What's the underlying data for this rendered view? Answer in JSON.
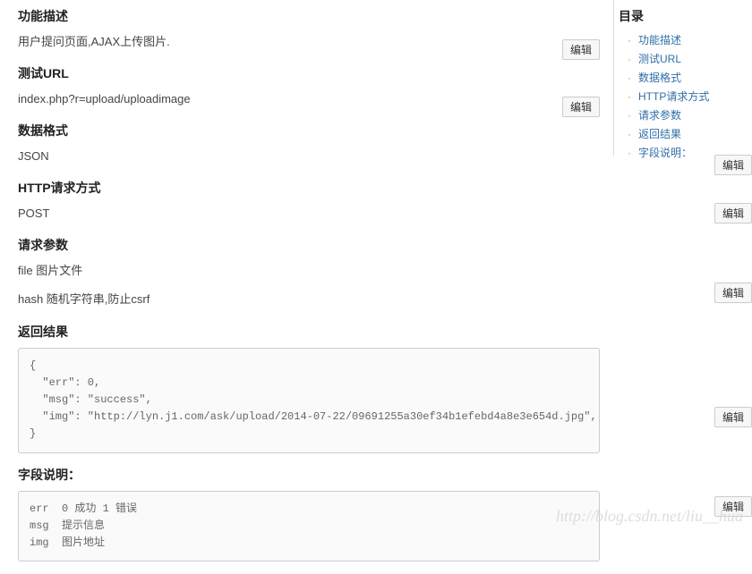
{
  "edit_label": "编辑",
  "sections": {
    "desc": {
      "title": "功能描述",
      "body": "用户提问页面,AJAX上传图片."
    },
    "url": {
      "title": "测试URL",
      "body": "index.php?r=upload/uploadimage"
    },
    "format": {
      "title": "数据格式",
      "body": "JSON"
    },
    "method": {
      "title": "HTTP请求方式",
      "body": "POST"
    },
    "params": {
      "title": "请求参数",
      "line1": "file 图片文件",
      "line2": "hash 随机字符串,防止csrf"
    },
    "result": {
      "title": "返回结果",
      "code": "{\n  \"err\": 0,\n  \"msg\": \"success\",\n  \"img\": \"http://lyn.j1.com/ask/upload/2014-07-22/09691255a30ef34b1efebd4a8e3e654d.jpg\",\n}"
    },
    "fields": {
      "title": "字段说明：",
      "code": "err  0 成功 1 错误\nmsg  提示信息\nimg  图片地址"
    }
  },
  "toc": {
    "title": "目录",
    "items": [
      "功能描述",
      "测试URL",
      "数据格式",
      "HTTP请求方式",
      "请求参数",
      "返回结果",
      "字段说明："
    ]
  },
  "watermark": "http://blog.csdn.net/liu__hua"
}
